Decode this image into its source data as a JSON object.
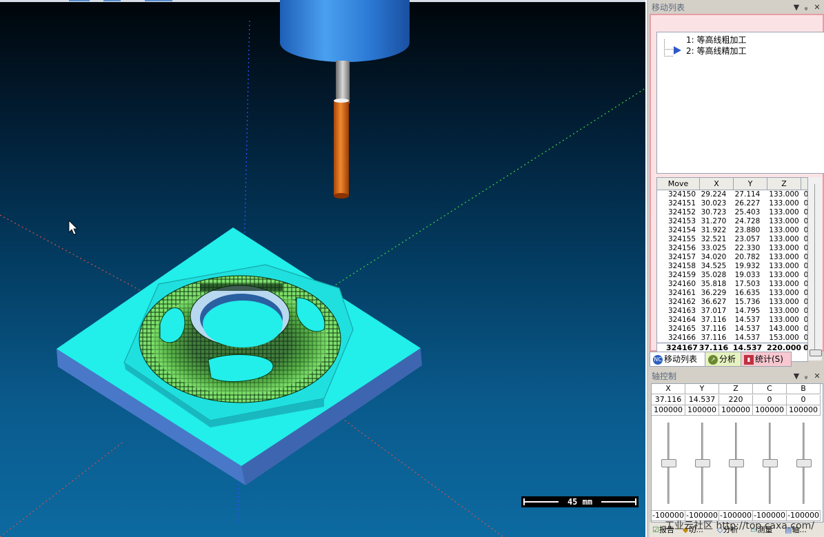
{
  "viewport": {
    "scale_label": "45 mm"
  },
  "move_list_panel": {
    "title": "移动列表",
    "tree_items": [
      {
        "label": "1: 等高线粗加工"
      },
      {
        "label": "2: 等高线精加工"
      }
    ]
  },
  "move_table": {
    "columns": [
      "Move",
      "X",
      "Y",
      "Z"
    ],
    "rows": [
      [
        "324150",
        "29.224",
        "27.114",
        "133.000",
        "0"
      ],
      [
        "324151",
        "30.023",
        "26.227",
        "133.000",
        "0"
      ],
      [
        "324152",
        "30.723",
        "25.403",
        "133.000",
        "0"
      ],
      [
        "324153",
        "31.270",
        "24.728",
        "133.000",
        "0"
      ],
      [
        "324154",
        "31.922",
        "23.880",
        "133.000",
        "0"
      ],
      [
        "324155",
        "32.521",
        "23.057",
        "133.000",
        "0"
      ],
      [
        "324156",
        "33.025",
        "22.330",
        "133.000",
        "0"
      ],
      [
        "324157",
        "34.020",
        "20.782",
        "133.000",
        "0"
      ],
      [
        "324158",
        "34.525",
        "19.932",
        "133.000",
        "0"
      ],
      [
        "324159",
        "35.028",
        "19.033",
        "133.000",
        "0"
      ],
      [
        "324160",
        "35.818",
        "17.503",
        "133.000",
        "0"
      ],
      [
        "324161",
        "36.229",
        "16.635",
        "133.000",
        "0"
      ],
      [
        "324162",
        "36.627",
        "15.736",
        "133.000",
        "0"
      ],
      [
        "324163",
        "37.017",
        "14.795",
        "133.000",
        "0"
      ],
      [
        "324164",
        "37.116",
        "14.537",
        "133.000",
        "0"
      ],
      [
        "324165",
        "37.116",
        "14.537",
        "143.000",
        "0"
      ],
      [
        "324166",
        "37.116",
        "14.537",
        "153.000",
        "0"
      ]
    ],
    "last_row": [
      "324167",
      "37.116",
      "14.537",
      "220.000",
      "0"
    ]
  },
  "tabs": {
    "move_list": "移动列表",
    "analysis": "分析",
    "statistics": "统计(S)",
    "nc_badge": "NC"
  },
  "axis_panel": {
    "title": "轴控制",
    "axes": [
      {
        "name": "X",
        "value": "37.116",
        "max": "100000",
        "min": "-100000"
      },
      {
        "name": "Y",
        "value": "14.537",
        "max": "100000",
        "min": "-100000"
      },
      {
        "name": "Z",
        "value": "220",
        "max": "100000",
        "min": "-100000"
      },
      {
        "name": "C",
        "value": "0",
        "max": "100000",
        "min": "-100000"
      },
      {
        "name": "B",
        "value": "0",
        "max": "100000",
        "min": "-100000"
      }
    ]
  },
  "footer_tabs": {
    "report": "报告",
    "tab2": "切...",
    "analysis": "分析",
    "measure": "测量",
    "axis": "轴..."
  },
  "watermark": "工业云社区 http://top.caxa.com/",
  "colors": {
    "stock_top": "#22eeea",
    "stock_side": "#4a78c8",
    "tool_holder": "#2f7ed8",
    "tool_cutter": "#e06a12",
    "panel_frame": "#e99ca4",
    "play_icon": "#2f58c8"
  }
}
